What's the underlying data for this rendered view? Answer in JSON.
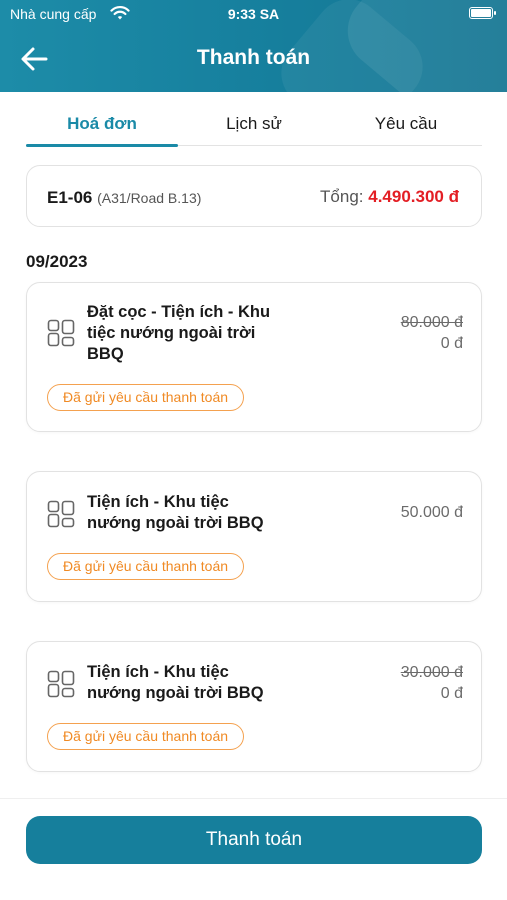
{
  "status_bar": {
    "carrier": "Nhà cung cấp",
    "time": "9:33 SA"
  },
  "header": {
    "title": "Thanh toán"
  },
  "tabs": [
    {
      "label": "Hoá đơn",
      "active": true
    },
    {
      "label": "Lịch sử",
      "active": false
    },
    {
      "label": "Yêu cầu",
      "active": false
    }
  ],
  "unit": {
    "code": "E1-06",
    "address": "(A31/Road B.13)",
    "total_label": "Tổng:",
    "total_amount": "4.490.300 đ"
  },
  "month": "09/2023",
  "bills": [
    {
      "title": "Đặt cọc - Tiện ích - Khu tiệc nướng ngoài trời BBQ",
      "original_price": "80.000 đ",
      "price": "0 đ",
      "status": "Đã gửi yêu cầu thanh toán",
      "icon": "grid-icon"
    },
    {
      "title": "Tiện ích - Khu tiệc nướng ngoài trời BBQ",
      "original_price": "",
      "price": "50.000 đ",
      "status": "Đã gửi yêu cầu thanh toán",
      "icon": "grid-icon"
    },
    {
      "title": "Tiện ích - Khu tiệc nướng ngoài trời BBQ",
      "original_price": "30.000 đ",
      "price": "0 đ",
      "status": "Đã gửi yêu cầu thanh toán",
      "icon": "grid-icon"
    }
  ],
  "footer": {
    "pay_button": "Thanh toán"
  },
  "colors": {
    "primary": "#167f9c",
    "total": "#e31e24",
    "badge": "#f08a24"
  }
}
